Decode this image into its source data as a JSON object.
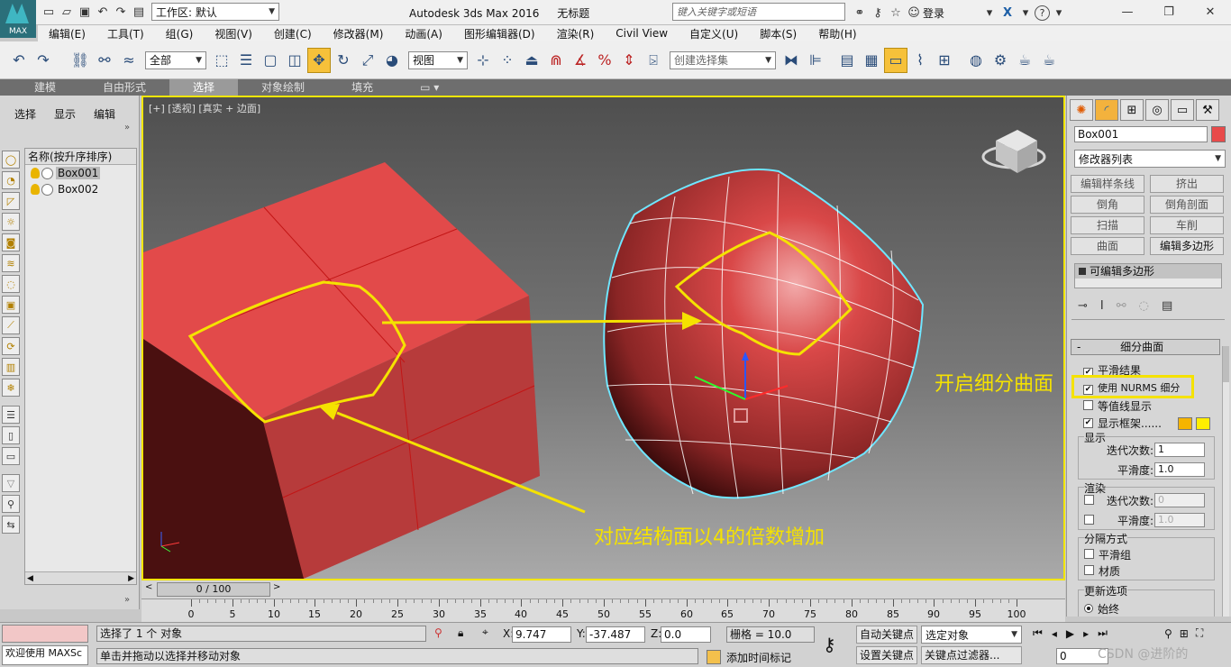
{
  "app": {
    "logo_text": "MAX",
    "title": "Autodesk 3ds Max 2016",
    "doc_name": "无标题",
    "workspace_label": "工作区: 默认",
    "search_placeholder": "键入关键字或短语",
    "login_label": "登录"
  },
  "menu": [
    "编辑(E)",
    "工具(T)",
    "组(G)",
    "视图(V)",
    "创建(C)",
    "修改器(M)",
    "动画(A)",
    "图形编辑器(D)",
    "渲染(R)",
    "Civil View",
    "自定义(U)",
    "脚本(S)",
    "帮助(H)"
  ],
  "toolbar": {
    "filter_value": "全部",
    "coord_value": "视图",
    "selset_placeholder": "创建选择集"
  },
  "ribbon": {
    "tabs": [
      "建模",
      "自由形式",
      "选择",
      "对象绘制",
      "填充"
    ],
    "active": "选择"
  },
  "scene_explorer": {
    "tabs": [
      "选择",
      "显示",
      "编辑"
    ],
    "column_header": "名称(按升序排序)",
    "objects": [
      {
        "name": "Box001",
        "selected": true
      },
      {
        "name": "Box002",
        "selected": false
      }
    ]
  },
  "viewport": {
    "label": "[+] [透视] [真实 + 边面]",
    "callout_left": "对应结构面以4的倍数增加",
    "callout_right": "开启细分曲面"
  },
  "command_panel": {
    "object_name": "Box001",
    "object_color": "#e84a4a",
    "modifier_list": "修改器列表",
    "buttons": [
      {
        "label": "编辑样条线",
        "enabled": false
      },
      {
        "label": "挤出",
        "enabled": false
      },
      {
        "label": "倒角",
        "enabled": false
      },
      {
        "label": "倒角剖面",
        "enabled": false
      },
      {
        "label": "扫描",
        "enabled": false
      },
      {
        "label": "车削",
        "enabled": false
      },
      {
        "label": "曲面",
        "enabled": false
      },
      {
        "label": "编辑多边形",
        "enabled": true
      }
    ],
    "stack_item": "可编辑多边形",
    "rollout_title": "细分曲面",
    "smooth_result": "平滑结果",
    "use_nurms": "使用 NURMS 细分",
    "isoline": "等值线显示",
    "show_cage": "显示框架......",
    "cage_colors": [
      "#f5b400",
      "#ffee00"
    ],
    "display_group": "显示",
    "display_iterations_label": "迭代次数:",
    "display_iterations": "1",
    "display_smoothness_label": "平滑度:",
    "display_smoothness": "1.0",
    "render_group": "渲染",
    "render_iterations_label": "迭代次数:",
    "render_iterations": "0",
    "render_smoothness_label": "平滑度:",
    "render_smoothness": "1.0",
    "separate_group": "分隔方式",
    "smoothing_groups": "平滑组",
    "materials": "材质",
    "update_group": "更新选项",
    "always": "始终"
  },
  "timeline": {
    "slider_label": "0 / 100",
    "ticks": [
      "0",
      "5",
      "10",
      "15",
      "20",
      "25",
      "30",
      "35",
      "40",
      "45",
      "50",
      "55",
      "60",
      "65",
      "70",
      "75",
      "80",
      "85",
      "90",
      "95",
      "100"
    ]
  },
  "status": {
    "maxscript": "欢迎使用 MAXSc",
    "selection_msg": "选择了 1 个 对象",
    "prompt_msg": "单击并拖动以选择并移动对象",
    "x_label": "X:",
    "x_value": "9.747",
    "y_label": "Y:",
    "y_value": "-37.487",
    "z_label": "Z:",
    "z_value": "0.0",
    "grid": "栅格 = 10.0",
    "add_time_tag": "添加时间标记",
    "auto_key": "自动关键点",
    "set_key": "设置关键点",
    "selected_object": "选定对象",
    "key_filters": "关键点过滤器...",
    "frame_value": "0",
    "watermark": "CSDN @进阶的"
  }
}
